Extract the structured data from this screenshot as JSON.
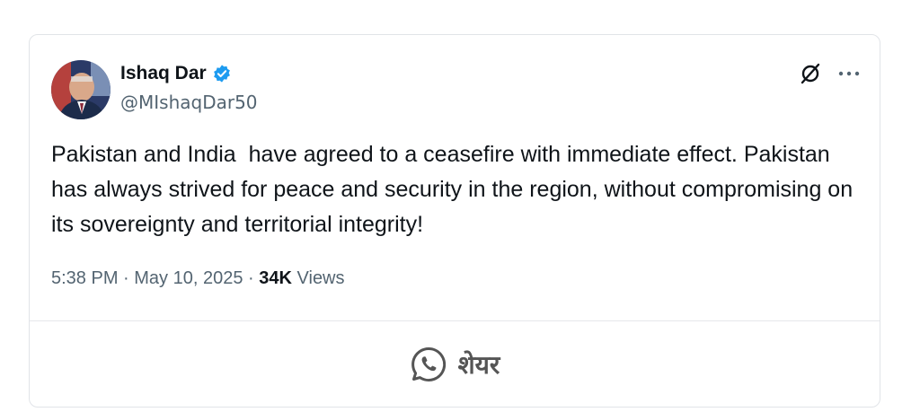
{
  "post": {
    "author": {
      "display_name": "Ishaq Dar",
      "handle": "@MIshaqDar50",
      "verified": true,
      "avatar_icon": "profile-photo"
    },
    "text": "Pakistan and India  have agreed to a ceasefire with immediate effect. Pakistan has always strived for peace and security in the region, without compromising on its sovereignty and territorial integrity!",
    "time": "5:38 PM",
    "separator": " · ",
    "date": "May 10, 2025",
    "views_count": "34K",
    "views_label": "Views"
  },
  "toolbar": {
    "grok_icon": "slashed-circle-icon",
    "more_icon": "more-dots-icon"
  },
  "share": {
    "label": "शेयर",
    "icon": "whatsapp-icon"
  },
  "colors": {
    "verified": "#1d9bf0",
    "text": "#0f1419",
    "muted": "#536471",
    "border": "#e1e4e8"
  }
}
